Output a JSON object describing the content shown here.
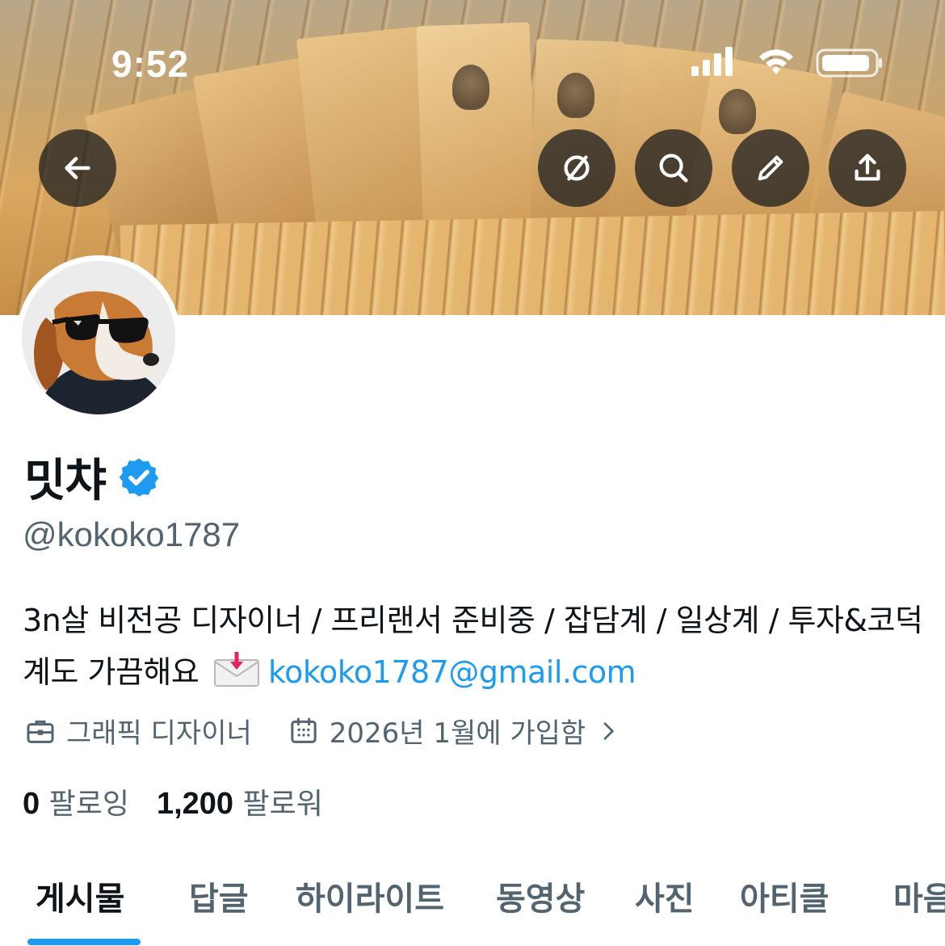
{
  "status_bar": {
    "time": "9:52"
  },
  "header": {
    "back_icon": "arrow-left-icon",
    "actions": [
      "circle-slash-icon",
      "search-icon",
      "pencil-icon",
      "share-icon"
    ]
  },
  "profile": {
    "display_name": "밋챠",
    "verified": true,
    "handle": "@kokoko1787",
    "bio_text": "3n살 비전공 디자이너 / 프리랜서 준비중 / 잡담계 / 일상계 / 투자&코덕계도 가끔해요",
    "bio_email": "kokoko1787@gmail.com",
    "category": "그래픽 디자이너",
    "joined": "2026년 1월에 가입함",
    "following_count": "0",
    "following_label": "팔로잉",
    "followers_count": "1,200",
    "followers_label": "팔로워"
  },
  "tabs": [
    {
      "label": "게시물",
      "active": true
    },
    {
      "label": "답글",
      "active": false
    },
    {
      "label": "하이라이트",
      "active": false
    },
    {
      "label": "동영상",
      "active": false
    },
    {
      "label": "사진",
      "active": false
    },
    {
      "label": "아티클",
      "active": false
    },
    {
      "label": "마음",
      "active": false
    }
  ],
  "colors": {
    "accent": "#1d9bf0",
    "text_primary": "#0f1419",
    "text_secondary": "#536471"
  }
}
